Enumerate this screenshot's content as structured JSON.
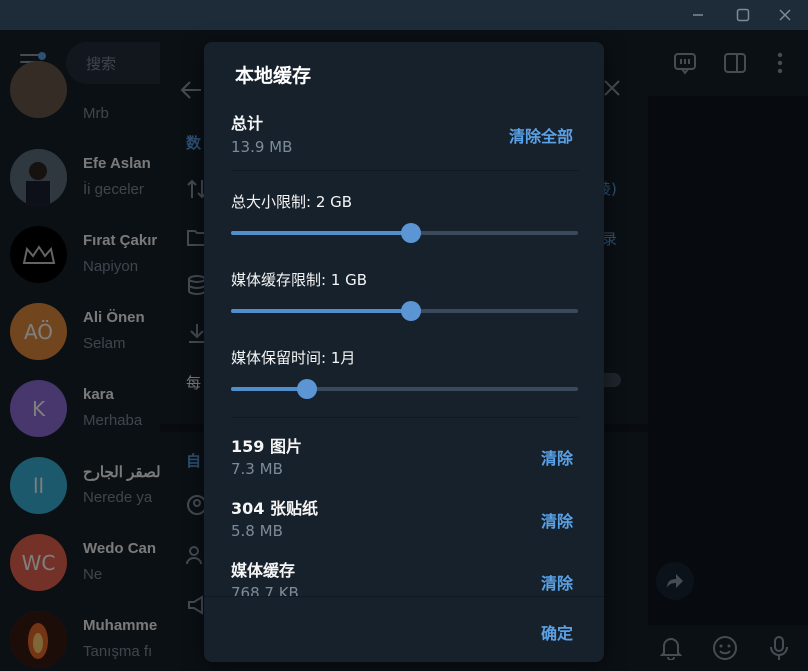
{
  "window": {
    "minimize_icon": "minimize-icon",
    "maximize_icon": "maximize-icon",
    "close_icon": "close-icon"
  },
  "search": {
    "placeholder": "搜索"
  },
  "chats": [
    {
      "name": "",
      "preview": "Mrb",
      "avatar_color": "#6b5a4a"
    },
    {
      "name": "Efe Aslan",
      "preview": "İi geceler",
      "avatar_color": "#4a5a6a"
    },
    {
      "name": "Fırat Çakır",
      "preview": "Napiyon",
      "avatar_color": "#000000"
    },
    {
      "name": "Ali Önen",
      "preview": "Selam",
      "initials": "AÖ",
      "avatar_color": "#e38d3c"
    },
    {
      "name": "kara",
      "preview": "Merhaba",
      "initials": "K",
      "avatar_color": "#8e6fd8"
    },
    {
      "name": "لصقر الجارح",
      "preview": "Nerede ya",
      "initials": "ll",
      "avatar_color": "#3bb3d8"
    },
    {
      "name": "Wedo Can",
      "preview": "Ne",
      "initials": "WC",
      "avatar_color": "#e8634f"
    },
    {
      "name": "Muhamme",
      "preview": "Tanışma fı",
      "avatar_color": "#8a3a1a"
    }
  ],
  "settings": {
    "section1": "数",
    "row1_tail": "绫)",
    "row2_tail": "录",
    "row_auto": "每",
    "section2": "自"
  },
  "dialog": {
    "title": "本地缓存",
    "total_label": "总计",
    "total_value": "13.9 MB",
    "clear_all": "清除全部",
    "sliders": [
      {
        "label": "总大小限制:",
        "value": "2 GB",
        "level": 0.52
      },
      {
        "label": "媒体缓存限制:",
        "value": "1 GB",
        "level": 0.52
      },
      {
        "label": "媒体保留时间:",
        "value": "1月",
        "level": 0.22
      }
    ],
    "items": [
      {
        "label": "159 图片",
        "size": "7.3 MB",
        "action": "清除"
      },
      {
        "label": "304 张贴纸",
        "size": "5.8 MB",
        "action": "清除"
      },
      {
        "label": "媒体缓存",
        "size": "768.7 KB",
        "action": "清除"
      }
    ],
    "ok": "确定"
  },
  "colors": {
    "accent": "#5ba1e6",
    "panel": "#17212b",
    "slider_fill": "#4f8fcd"
  }
}
